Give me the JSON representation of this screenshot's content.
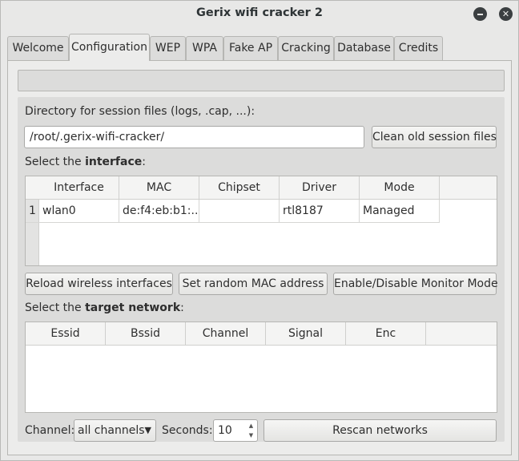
{
  "window": {
    "title": "Gerix wifi cracker 2"
  },
  "tabs": [
    {
      "label": "Welcome"
    },
    {
      "label": "Configuration"
    },
    {
      "label": "WEP"
    },
    {
      "label": "WPA"
    },
    {
      "label": "Fake AP"
    },
    {
      "label": "Cracking"
    },
    {
      "label": "Database"
    },
    {
      "label": "Credits"
    }
  ],
  "active_tab": "Configuration",
  "config": {
    "dir_label": "Directory for session files (logs, .cap, ...):",
    "dir_value": "/root/.gerix-wifi-cracker/",
    "clean_button": "Clean old session files",
    "interface_label_pre": "Select the ",
    "interface_label_bold": "interface",
    "interface_label_post": ":",
    "interface_table": {
      "headers": [
        "Interface",
        "MAC",
        "Chipset",
        "Driver",
        "Mode"
      ],
      "rows": [
        {
          "num": "1",
          "interface": "wlan0",
          "mac": "de:f4:eb:b1:...",
          "chipset": "",
          "driver": "rtl8187",
          "mode": "Managed"
        }
      ]
    },
    "reload_button": "Reload wireless interfaces",
    "random_mac_button": "Set random MAC address",
    "monitor_button": "Enable/Disable Monitor Mode",
    "target_label_pre": "Select the ",
    "target_label_bold": "target network",
    "target_label_post": ":",
    "network_table": {
      "headers": [
        "Essid",
        "Bssid",
        "Channel",
        "Signal",
        "Enc"
      ]
    },
    "channel_label": "Channel:",
    "channel_value": "all channels",
    "seconds_label": "Seconds:",
    "seconds_value": "10",
    "rescan_button": "Rescan networks"
  },
  "icons": {
    "minimize": "minimize-icon",
    "close": "close-icon",
    "dropdown": "chevron-down-icon",
    "spin_up": "arrow-up-icon",
    "spin_down": "arrow-down-icon"
  }
}
